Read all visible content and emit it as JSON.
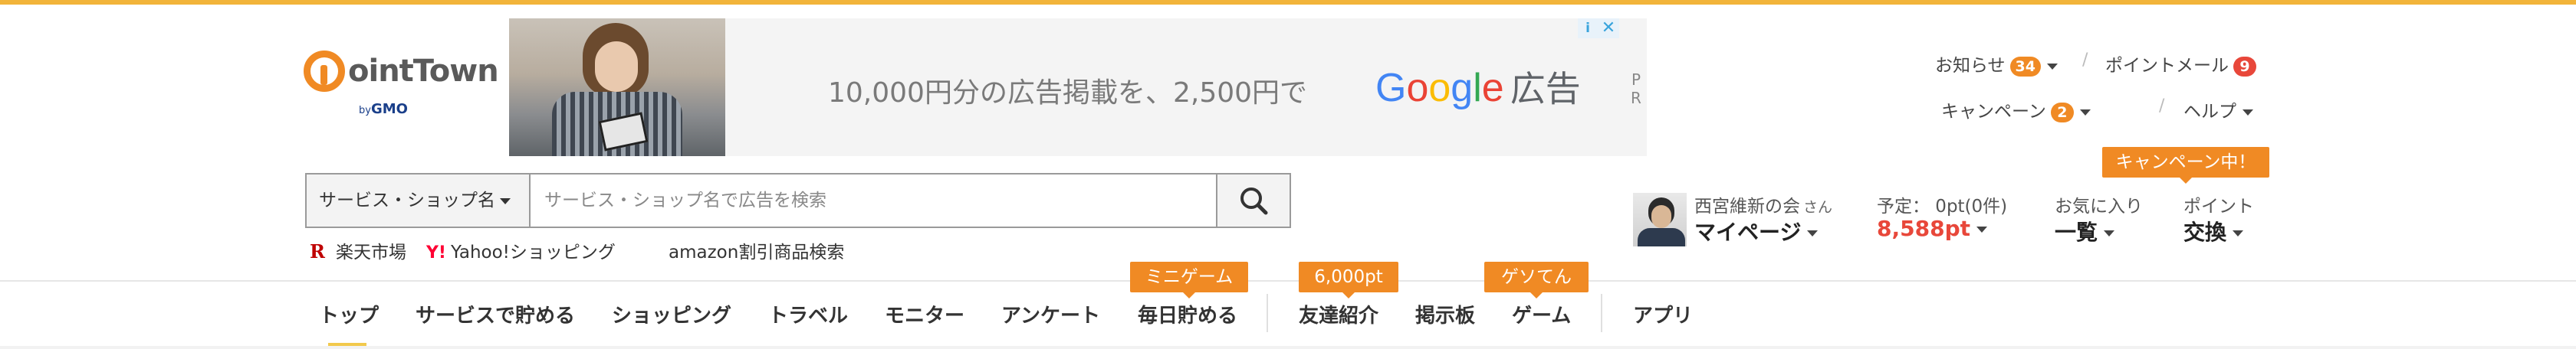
{
  "brand": {
    "logo_text": "ointTown",
    "logo_sub_by": "by",
    "logo_sub": "GMO"
  },
  "ad": {
    "headline": "10,000円分の広告掲載を、2,500円で",
    "google_letters": [
      "G",
      "o",
      "o",
      "g",
      "l",
      "e"
    ],
    "google_suffix": "広告",
    "pr_p": "P",
    "pr_r": "R",
    "info_icon": "i",
    "close_icon": "✕"
  },
  "header_links": {
    "news": {
      "label": "お知らせ",
      "badge": "34"
    },
    "point_mail": {
      "label": "ポイントメール",
      "badge": "9"
    },
    "campaign": {
      "label": "キャンペーン",
      "badge": "2"
    },
    "help": {
      "label": "ヘルプ"
    },
    "separator": "/"
  },
  "search": {
    "category": "サービス・ショップ名",
    "placeholder": "サービス・ショップ名で広告を検索",
    "value": ""
  },
  "quick_links": {
    "rakuten": {
      "icon": "R",
      "label": "楽天市場"
    },
    "yahoo": {
      "icon": "Y!",
      "label": "Yahoo!ショッピング"
    },
    "amazon": {
      "label": "amazon割引商品検索"
    }
  },
  "user": {
    "name": "西宮維新の会",
    "honorific": "さん",
    "mypage": "マイページ",
    "scheduled": "予定： 0pt(0件)",
    "points": "8,588pt",
    "favorites_top": "お気に入り",
    "favorites_bottom": "一覧",
    "exchange_top": "ポイント",
    "exchange_bottom": "交換",
    "campaign_tag": "キャンペーン中！"
  },
  "nav": {
    "items": [
      "トップ",
      "サービスで貯める",
      "ショッピング",
      "トラベル",
      "モニター",
      "アンケート",
      "毎日貯める",
      "友達紹介",
      "掲示板",
      "ゲーム",
      "アプリ"
    ],
    "tags": {
      "daily": "ミニゲーム",
      "friends": "6,000pt",
      "game": "ゲソてん"
    },
    "active_index": 0
  },
  "colors": {
    "accent": "#f08a24",
    "badge_red": "#e8473a",
    "points_red": "#e8473a",
    "top_stripe": "#f2b43a"
  }
}
